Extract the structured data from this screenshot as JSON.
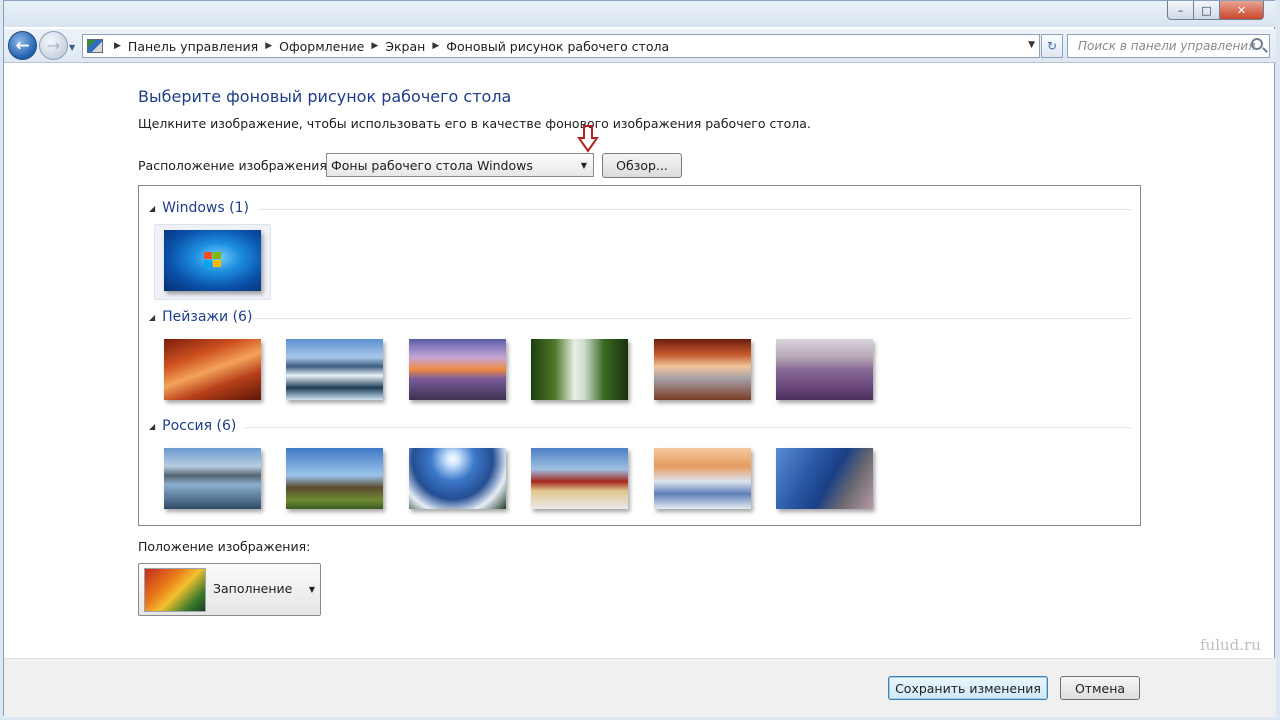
{
  "window": {
    "caption_min": "–",
    "caption_max": "□",
    "caption_close": "✕"
  },
  "nav": {
    "back_glyph": "←",
    "forward_glyph": "→",
    "dropdown_glyph": "▼",
    "breadcrumb": [
      "Панель управления",
      "Оформление",
      "Экран",
      "Фоновый рисунок рабочего стола"
    ],
    "crumb_sep": "▶",
    "refresh_glyph": "↻",
    "search_placeholder": "Поиск в панели управления"
  },
  "page": {
    "heading": "Выберите фоновый рисунок рабочего стола",
    "subtext": "Щелкните изображение, чтобы использовать его в качестве фонового изображения рабочего стола.",
    "location_label": "Расположение изображения:",
    "location_value": "Фоны рабочего стола Windows",
    "browse_label": "Обзор...",
    "position_label": "Положение изображения:",
    "position_value": "Заполнение",
    "save_label": "Сохранить изменения",
    "cancel_label": "Отмена",
    "watermark": "fulud.ru"
  },
  "gallery": {
    "groups": [
      {
        "title": "Windows (1)",
        "thumbs": [
          "windows-7-logo"
        ]
      },
      {
        "title": "Пейзажи (6)",
        "thumbs": [
          "red-canyon",
          "ice-lake",
          "rocky-shore-sunset",
          "waterfall",
          "arch-rock",
          "lavender-field"
        ]
      },
      {
        "title": "Россия (6)",
        "thumbs": [
          "mountain-lake",
          "windmill",
          "snowy-mountain-sun",
          "red-square",
          "winter-bridge",
          "coastal-cliff"
        ]
      }
    ],
    "selected_thumb": "windows-7-logo"
  },
  "colors": {
    "heading": "#1e3e8a",
    "arrow": "#b22222"
  }
}
